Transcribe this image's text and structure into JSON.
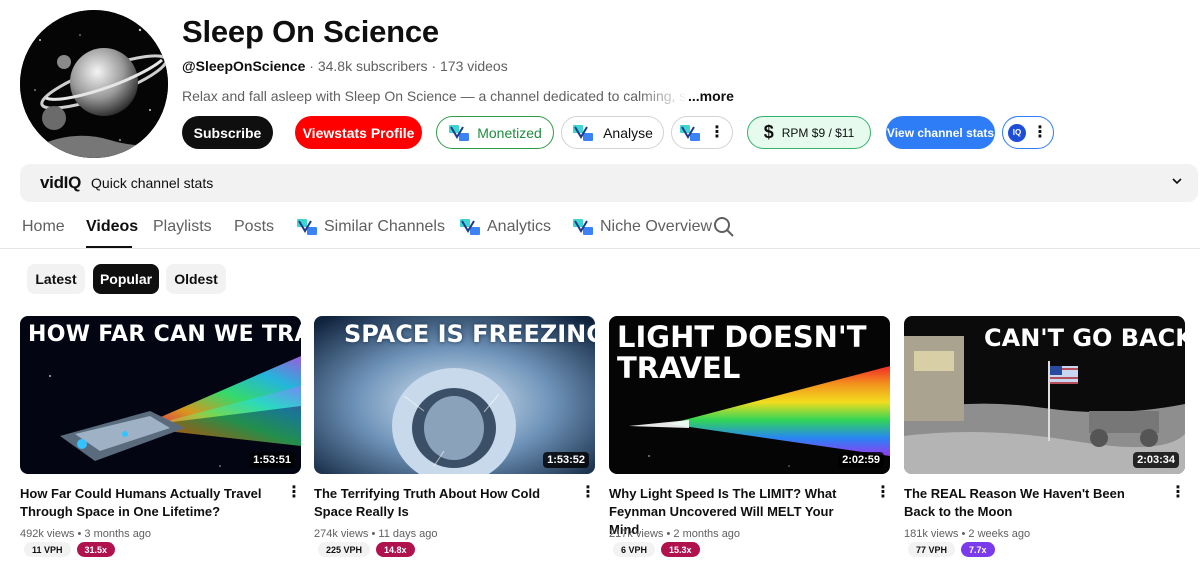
{
  "channel": {
    "title": "Sleep On Science",
    "handle": "@SleepOnScience",
    "subscribers": "34.8k subscribers",
    "videos_count": "173 videos",
    "separator": "·",
    "description": "Relax and fall asleep with Sleep On Science — a channel dedicated to calming, science-ba",
    "more_label": "...more"
  },
  "actions": {
    "subscribe": "Subscribe",
    "viewstats": "Viewstats Profile",
    "monetized": "Monetized",
    "analyse": "Analyse",
    "rpm": "RPM $9 / $11",
    "view_channel_stats": "View channel stats",
    "iq_badge": "IQ"
  },
  "quick_stats": {
    "brand_vid": "vid",
    "brand_iq": "IQ",
    "label": "Quick channel stats"
  },
  "tabs": [
    {
      "label": "Home"
    },
    {
      "label": "Videos"
    },
    {
      "label": "Playlists"
    },
    {
      "label": "Posts"
    },
    {
      "label": "Similar Channels"
    },
    {
      "label": "Analytics"
    },
    {
      "label": "Niche Overview"
    }
  ],
  "filters": [
    "Latest",
    "Popular",
    "Oldest"
  ],
  "videos": [
    {
      "thumb_text": "HOW FAR CAN WE TRAVEL?",
      "duration": "1:53:51",
      "title": "How Far Could Humans Actually Travel Through Space in One Lifetime?",
      "views": "492k views",
      "age": "3 months ago",
      "vph": "11 VPH",
      "multiplier": "31.5x",
      "multiplier_color": "#b0124e"
    },
    {
      "thumb_text": "SPACE IS FREEZING",
      "duration": "1:53:52",
      "title": "The Terrifying Truth About How Cold Space Really Is",
      "views": "274k views",
      "age": "11 days ago",
      "vph": "225 VPH",
      "multiplier": "14.8x",
      "multiplier_color": "#b0124e"
    },
    {
      "thumb_text_line1": "LIGHT DOESN'T",
      "thumb_text_line2": "TRAVEL",
      "duration": "2:02:59",
      "title": "Why Light Speed Is The LIMIT? What Feynman Uncovered Will MELT Your Mind",
      "views": "217k views",
      "age": "2 months ago",
      "vph": "6 VPH",
      "multiplier": "15.3x",
      "multiplier_color": "#b0124e"
    },
    {
      "thumb_text": "CAN'T GO BACK",
      "duration": "2:03:34",
      "title": "The REAL Reason We Haven't Been Back to the Moon",
      "views": "181k views",
      "age": "2 weeks ago",
      "vph": "77 VPH",
      "multiplier": "7.7x",
      "multiplier_color": "#7c3aed"
    }
  ],
  "colors": {
    "subscribe_bg": "#0f0f0f",
    "viewstats_bg": "#ff0000",
    "monetized_green": "#1e8e3e",
    "view_stats_blue": "#2f7df6"
  },
  "icons": [
    "vidiq-logo-icon",
    "dollar-icon",
    "more-dots-icon",
    "search-icon",
    "chevron-down-icon",
    "kebab-menu-icon"
  ]
}
